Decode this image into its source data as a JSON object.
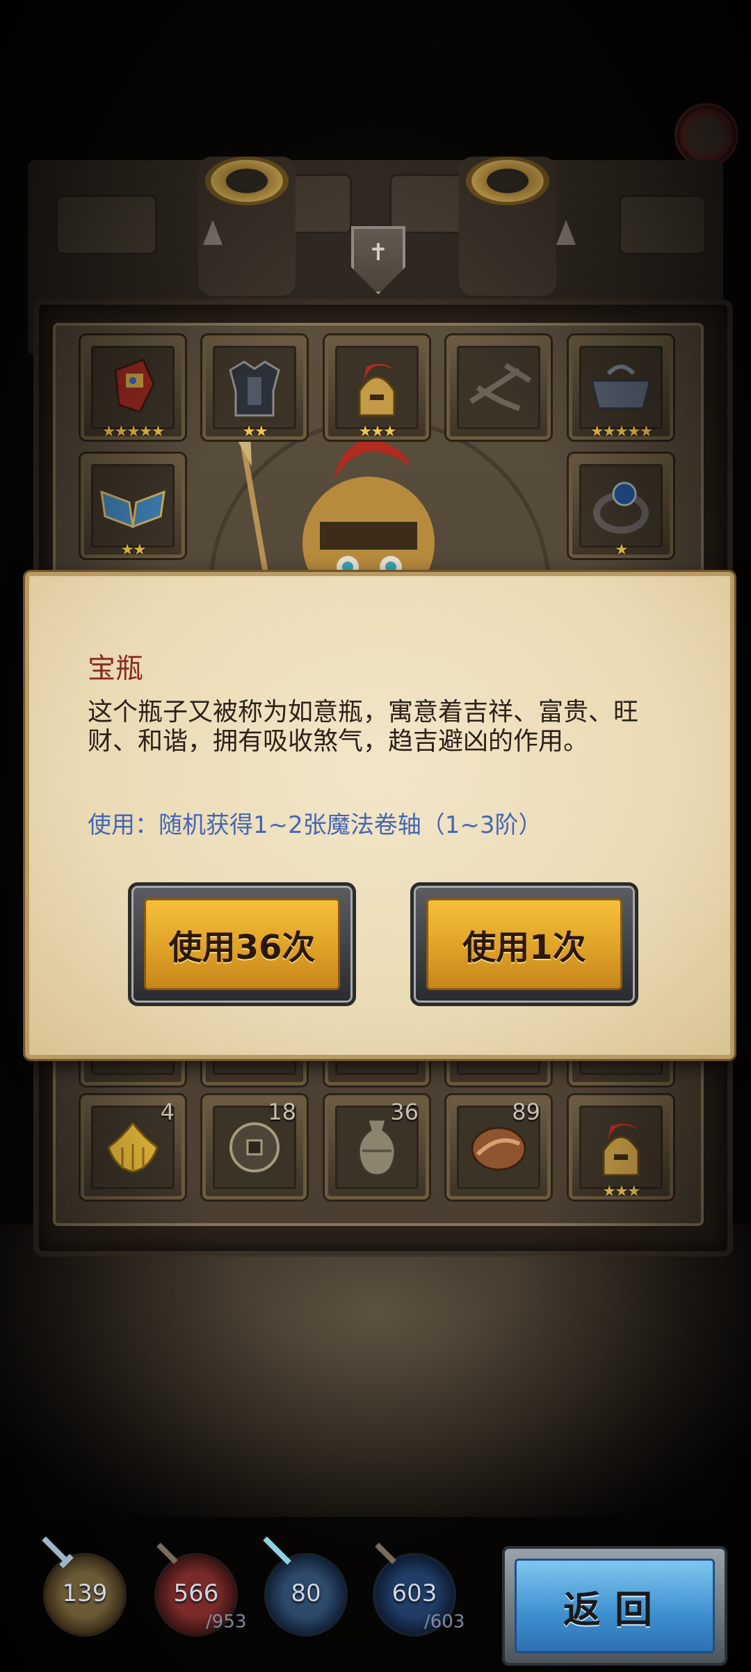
{
  "dialog": {
    "title": "宝瓶",
    "description": "这个瓶子又被称为如意瓶，寓意着吉祥、富贵、旺财、和谐，拥有吸收煞气，趋吉避凶的作用。",
    "usage": "使用：随机获得1~2张魔法卷轴（1~3阶）",
    "use_all_label": "使用36次",
    "use_one_label": "使用1次"
  },
  "equipment": [
    {
      "icon": "gauntlet-icon",
      "stars": "★★★★★"
    },
    {
      "icon": "armor-icon",
      "stars": "★★"
    },
    {
      "icon": "helmet-icon",
      "stars": "★★★"
    },
    {
      "icon": "empty-weapon-slot-icon",
      "stars": ""
    },
    {
      "icon": "lock-amulet-icon",
      "stars": "★★★★★"
    },
    {
      "icon": "shoulder-guard-icon",
      "stars": "★★"
    },
    {
      "icon": "ring-icon",
      "stars": "★"
    }
  ],
  "inventory": [
    {
      "icon": "buddha-hand-fruit-icon",
      "count": "4"
    },
    {
      "icon": "ancient-coin-icon",
      "count": "18"
    },
    {
      "icon": "vase-icon",
      "count": "36"
    },
    {
      "icon": "bread-loaf-icon",
      "count": "89"
    },
    {
      "icon": "helmet-icon",
      "stars": "★★★"
    }
  ],
  "hud": {
    "attack": "139",
    "hp": "566",
    "hp_max": "/953",
    "defense": "80",
    "mp": "603",
    "mp_max": "/603"
  },
  "back_label": "返回",
  "colors": {
    "title": "#8a2a1c",
    "usage": "#4566b5",
    "gold_button": "#f0b533",
    "blue_button": "#4a9bd8"
  }
}
